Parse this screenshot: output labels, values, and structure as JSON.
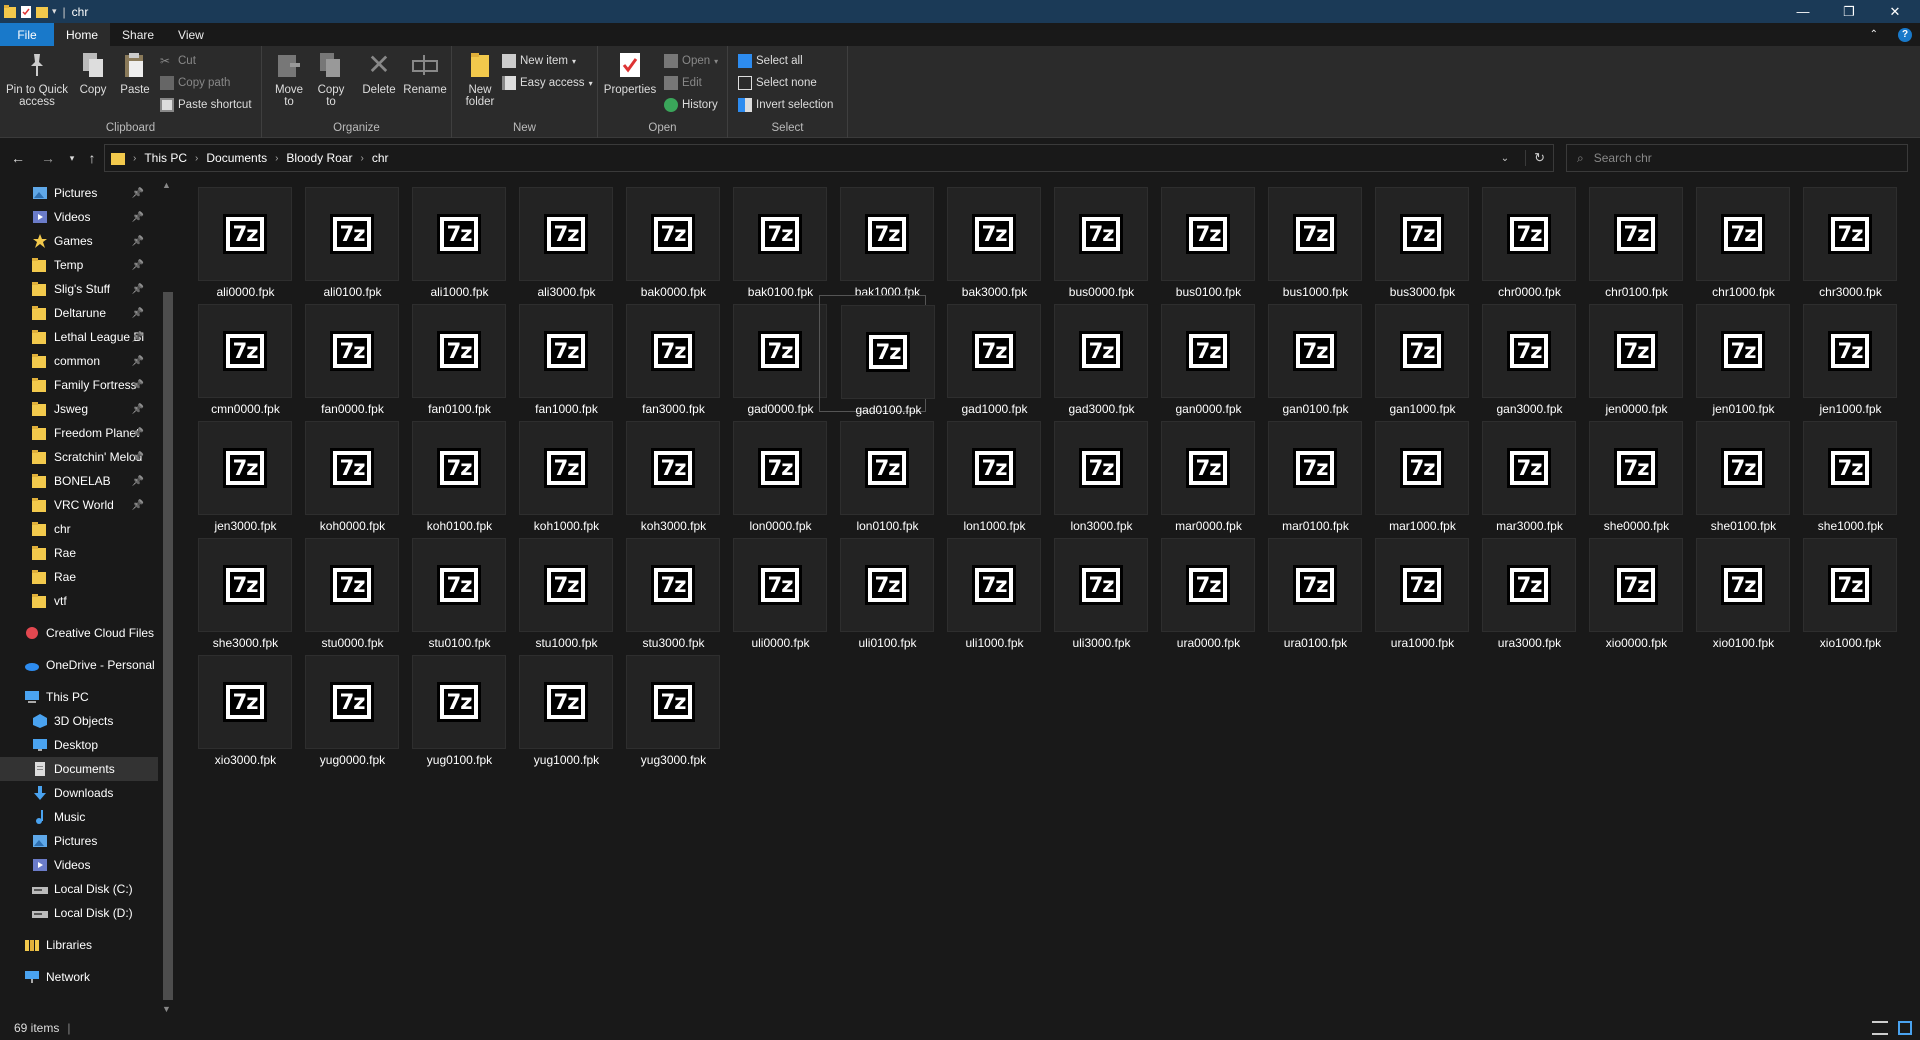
{
  "window": {
    "title": "chr",
    "controls": {
      "minimize": "—",
      "maximize": "❐",
      "close": "✕"
    }
  },
  "ribbon_tabs": [
    "File",
    "Home",
    "Share",
    "View"
  ],
  "ribbon": {
    "clipboard": {
      "pin_label": "Pin to Quick access",
      "copy_label": "Copy",
      "paste_label": "Paste",
      "cut_label": "Cut",
      "copy_path_label": "Copy path",
      "paste_shortcut_label": "Paste shortcut",
      "group_label": "Clipboard"
    },
    "organize": {
      "move_label": "Move to",
      "copy_to_label": "Copy to",
      "delete_label": "Delete",
      "rename_label": "Rename",
      "group_label": "Organize"
    },
    "new": {
      "new_folder_label": "New folder",
      "new_item_label": "New item",
      "easy_access_label": "Easy access",
      "group_label": "New"
    },
    "open": {
      "properties_label": "Properties",
      "open_label": "Open",
      "edit_label": "Edit",
      "history_label": "History",
      "group_label": "Open"
    },
    "select": {
      "select_all_label": "Select all",
      "select_none_label": "Select none",
      "invert_label": "Invert selection",
      "group_label": "Select"
    }
  },
  "breadcrumb": [
    "This PC",
    "Documents",
    "Bloody Roar",
    "chr"
  ],
  "search": {
    "placeholder": "Search chr"
  },
  "nav": {
    "quick_access": [
      {
        "label": "Pictures",
        "icon": "pictures-icon",
        "pinned": true
      },
      {
        "label": "Videos",
        "icon": "videos-icon",
        "pinned": true
      },
      {
        "label": "Games",
        "icon": "star-icon",
        "pinned": true
      },
      {
        "label": "Temp",
        "icon": "folder-icon",
        "pinned": true
      },
      {
        "label": "Slig's Stuff",
        "icon": "folder-icon",
        "pinned": true
      },
      {
        "label": "Deltarune",
        "icon": "folder-icon",
        "pinned": true
      },
      {
        "label": "Lethal League Bla",
        "icon": "folder-icon",
        "pinned": true
      },
      {
        "label": "common",
        "icon": "folder-icon",
        "pinned": true
      },
      {
        "label": "Family Fortress",
        "icon": "folder-icon",
        "pinned": true
      },
      {
        "label": "Jsweg",
        "icon": "folder-icon",
        "pinned": true
      },
      {
        "label": "Freedom Planet",
        "icon": "folder-icon",
        "pinned": true
      },
      {
        "label": "Scratchin' Melod",
        "icon": "folder-icon",
        "pinned": true
      },
      {
        "label": "BONELAB",
        "icon": "folder-icon",
        "pinned": true
      },
      {
        "label": "VRC World",
        "icon": "folder-icon",
        "pinned": true
      },
      {
        "label": "chr",
        "icon": "folder-icon",
        "pinned": false
      },
      {
        "label": "Rae",
        "icon": "folder-icon",
        "pinned": false
      },
      {
        "label": "Rae",
        "icon": "folder-icon",
        "pinned": false
      },
      {
        "label": "vtf",
        "icon": "folder-icon",
        "pinned": false
      }
    ],
    "creative_cloud": "Creative Cloud Files",
    "onedrive": "OneDrive - Personal",
    "this_pc": "This PC",
    "this_pc_items": [
      {
        "label": "3D Objects",
        "icon": "3d-objects-icon"
      },
      {
        "label": "Desktop",
        "icon": "desktop-icon"
      },
      {
        "label": "Documents",
        "icon": "documents-icon"
      },
      {
        "label": "Downloads",
        "icon": "downloads-icon"
      },
      {
        "label": "Music",
        "icon": "music-icon"
      },
      {
        "label": "Pictures",
        "icon": "pictures-icon"
      },
      {
        "label": "Videos",
        "icon": "videos-icon"
      },
      {
        "label": "Local Disk (C:)",
        "icon": "drive-icon"
      },
      {
        "label": "Local Disk (D:)",
        "icon": "drive-icon"
      }
    ],
    "libraries": "Libraries",
    "network": "Network",
    "selected": "Documents"
  },
  "file_icon_text": "7z",
  "files": [
    "ali0000.fpk",
    "ali0100.fpk",
    "ali1000.fpk",
    "ali3000.fpk",
    "bak0000.fpk",
    "bak0100.fpk",
    "bak1000.fpk",
    "bak3000.fpk",
    "bus0000.fpk",
    "bus0100.fpk",
    "bus1000.fpk",
    "bus3000.fpk",
    "chr0000.fpk",
    "chr0100.fpk",
    "chr1000.fpk",
    "chr3000.fpk",
    "cmn0000.fpk",
    "fan0000.fpk",
    "fan0100.fpk",
    "fan1000.fpk",
    "fan3000.fpk",
    "gad0000.fpk",
    "gad0100.fpk",
    "gad1000.fpk",
    "gad3000.fpk",
    "gan0000.fpk",
    "gan0100.fpk",
    "gan1000.fpk",
    "gan3000.fpk",
    "jen0000.fpk",
    "jen0100.fpk",
    "jen1000.fpk",
    "jen3000.fpk",
    "koh0000.fpk",
    "koh0100.fpk",
    "koh1000.fpk",
    "koh3000.fpk",
    "lon0000.fpk",
    "lon0100.fpk",
    "lon1000.fpk",
    "lon3000.fpk",
    "mar0000.fpk",
    "mar0100.fpk",
    "mar1000.fpk",
    "mar3000.fpk",
    "she0000.fpk",
    "she0100.fpk",
    "she1000.fpk",
    "she3000.fpk",
    "stu0000.fpk",
    "stu0100.fpk",
    "stu1000.fpk",
    "stu3000.fpk",
    "uli0000.fpk",
    "uli0100.fpk",
    "uli1000.fpk",
    "uli3000.fpk",
    "ura0000.fpk",
    "ura0100.fpk",
    "ura1000.fpk",
    "ura3000.fpk",
    "xio0000.fpk",
    "xio0100.fpk",
    "xio1000.fpk",
    "xio3000.fpk",
    "yug0000.fpk",
    "yug0100.fpk",
    "yug1000.fpk",
    "yug3000.fpk"
  ],
  "hovered_file": "gad0100.fpk",
  "status": {
    "item_count": "69 items"
  },
  "colors": {
    "title_bar": "#1b3a57",
    "file_tab": "#1979ca",
    "folder": "#f2c94c",
    "accent": "#2d8cf0"
  }
}
